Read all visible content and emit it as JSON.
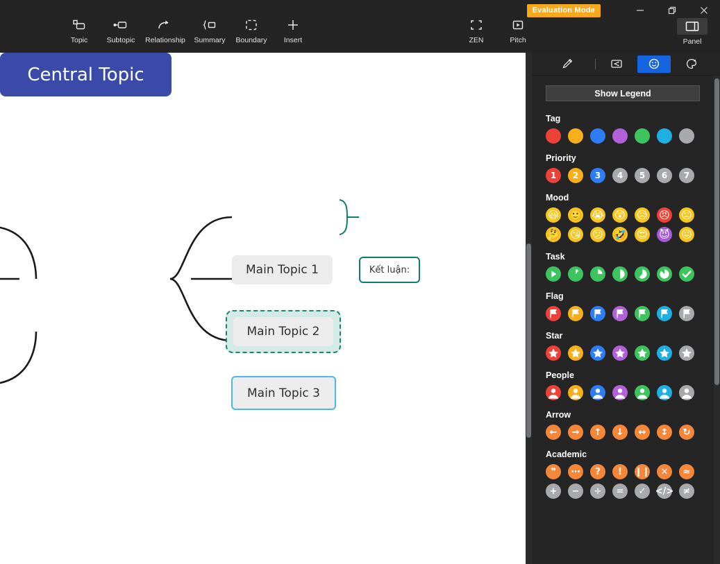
{
  "window": {
    "evaluation_badge": "Evaluation Mode",
    "minimize_icon": "minimize-icon",
    "maximize_icon": "restore-icon",
    "close_icon": "close-icon"
  },
  "toolbar": {
    "items": [
      {
        "label": "Topic",
        "icon": "topic-icon"
      },
      {
        "label": "Subtopic",
        "icon": "subtopic-icon"
      },
      {
        "label": "Relationship",
        "icon": "relationship-icon"
      },
      {
        "label": "Summary",
        "icon": "summary-icon"
      },
      {
        "label": "Boundary",
        "icon": "boundary-icon"
      },
      {
        "label": "Insert",
        "icon": "plus-icon"
      }
    ],
    "right_items": [
      {
        "label": "ZEN",
        "icon": "zen-icon"
      },
      {
        "label": "Pitch",
        "icon": "pitch-icon"
      }
    ],
    "panel": {
      "label": "Panel",
      "icon": "panel-icon"
    }
  },
  "canvas": {
    "central_topic": "Central Topic",
    "nodes": [
      {
        "id": "mt1",
        "label": "Main Topic 1"
      },
      {
        "id": "mt2",
        "label": "Main Topic 2"
      },
      {
        "id": "mt3",
        "label": "Main Topic 3"
      }
    ],
    "summary": {
      "label": "Kết luận:"
    }
  },
  "panel": {
    "tabs": [
      {
        "name": "style-tab",
        "icon": "brush-icon",
        "active": false
      },
      {
        "name": "outline-tab",
        "icon": "outline-icon",
        "active": false
      },
      {
        "name": "sticker-tab",
        "icon": "smiley-icon",
        "active": true
      },
      {
        "name": "theme-tab",
        "icon": "palette-icon",
        "active": false
      }
    ],
    "show_legend_label": "Show Legend",
    "sections": [
      {
        "title": "Tag",
        "kind": "dot",
        "items": [
          {
            "name": "tag-red",
            "color": "#EE4238",
            "label": ""
          },
          {
            "name": "tag-orange",
            "color": "#F7B01C",
            "label": ""
          },
          {
            "name": "tag-blue",
            "color": "#2D7DF6",
            "label": ""
          },
          {
            "name": "tag-purple",
            "color": "#B262D8",
            "label": ""
          },
          {
            "name": "tag-green",
            "color": "#3EC45E",
            "label": ""
          },
          {
            "name": "tag-cyan",
            "color": "#1EAFE3",
            "label": ""
          },
          {
            "name": "tag-gray",
            "color": "#A7A9AC",
            "label": ""
          }
        ]
      },
      {
        "title": "Priority",
        "kind": "number",
        "items": [
          {
            "name": "priority-1",
            "color": "#EE4238",
            "label": "1"
          },
          {
            "name": "priority-2",
            "color": "#F7B01C",
            "label": "2"
          },
          {
            "name": "priority-3",
            "color": "#2D7DF6",
            "label": "3"
          },
          {
            "name": "priority-4",
            "color": "#A7A9AC",
            "label": "4"
          },
          {
            "name": "priority-5",
            "color": "#A7A9AC",
            "label": "5"
          },
          {
            "name": "priority-6",
            "color": "#A7A9AC",
            "label": "6"
          },
          {
            "name": "priority-7",
            "color": "#A7A9AC",
            "label": "7"
          }
        ]
      },
      {
        "title": "Mood",
        "kind": "emoji",
        "items": [
          {
            "name": "mood-grin",
            "color": "#F7C51E",
            "label": "😃"
          },
          {
            "name": "mood-smile",
            "color": "#F7C51E",
            "label": "🙂"
          },
          {
            "name": "mood-cry",
            "color": "#F7C51E",
            "label": "😭"
          },
          {
            "name": "mood-shocked",
            "color": "#F7C51E",
            "label": "😲"
          },
          {
            "name": "mood-sad",
            "color": "#F7C51E",
            "label": "😥"
          },
          {
            "name": "mood-angry",
            "color": "#EE4238",
            "label": "😠"
          },
          {
            "name": "mood-neutral",
            "color": "#F7C51E",
            "label": "😐"
          },
          {
            "name": "mood-thinking",
            "color": "#F7C51E",
            "label": "🤔"
          },
          {
            "name": "mood-kiss",
            "color": "#F7C51E",
            "label": "😘"
          },
          {
            "name": "mood-confused",
            "color": "#F7C51E",
            "label": "😕"
          },
          {
            "name": "mood-rofl",
            "color": "#F7C51E",
            "label": "🤣"
          },
          {
            "name": "mood-heart-eyes",
            "color": "#F7C51E",
            "label": "😍"
          },
          {
            "name": "mood-devil",
            "color": "#A35BD8",
            "label": "😈"
          },
          {
            "name": "mood-x-eyes",
            "color": "#F7C51E",
            "label": "😖"
          }
        ]
      },
      {
        "title": "Task",
        "kind": "progress",
        "items": [
          {
            "name": "task-start",
            "color": "#3EC45E",
            "label": "",
            "progress": 0
          },
          {
            "name": "task-1-8",
            "color": "#3EC45E",
            "label": "",
            "progress": 12
          },
          {
            "name": "task-1-4",
            "color": "#3EC45E",
            "label": "",
            "progress": 25
          },
          {
            "name": "task-1-2",
            "color": "#3EC45E",
            "label": "",
            "progress": 50
          },
          {
            "name": "task-5-8",
            "color": "#3EC45E",
            "label": "",
            "progress": 62
          },
          {
            "name": "task-7-8",
            "color": "#3EC45E",
            "label": "",
            "progress": 87
          },
          {
            "name": "task-done",
            "color": "#3EC45E",
            "label": "✓",
            "progress": 100
          }
        ]
      },
      {
        "title": "Flag",
        "kind": "flag",
        "items": [
          {
            "name": "flag-red",
            "color": "#EE4238",
            "label": ""
          },
          {
            "name": "flag-orange",
            "color": "#F7B01C",
            "label": ""
          },
          {
            "name": "flag-blue",
            "color": "#2D7DF6",
            "label": ""
          },
          {
            "name": "flag-purple",
            "color": "#B262D8",
            "label": ""
          },
          {
            "name": "flag-green",
            "color": "#3EC45E",
            "label": ""
          },
          {
            "name": "flag-cyan",
            "color": "#1EAFE3",
            "label": ""
          },
          {
            "name": "flag-gray",
            "color": "#A7A9AC",
            "label": ""
          }
        ]
      },
      {
        "title": "Star",
        "kind": "star",
        "items": [
          {
            "name": "star-red",
            "color": "#EE4238",
            "label": ""
          },
          {
            "name": "star-orange",
            "color": "#F7B01C",
            "label": ""
          },
          {
            "name": "star-blue",
            "color": "#2D7DF6",
            "label": ""
          },
          {
            "name": "star-purple",
            "color": "#B262D8",
            "label": ""
          },
          {
            "name": "star-green",
            "color": "#3EC45E",
            "label": ""
          },
          {
            "name": "star-cyan",
            "color": "#1EAFE3",
            "label": ""
          },
          {
            "name": "star-gray",
            "color": "#A7A9AC",
            "label": ""
          }
        ]
      },
      {
        "title": "People",
        "kind": "person",
        "items": [
          {
            "name": "people-red",
            "color": "#EE4238",
            "label": ""
          },
          {
            "name": "people-orange",
            "color": "#F7B01C",
            "label": ""
          },
          {
            "name": "people-blue",
            "color": "#2D7DF6",
            "label": ""
          },
          {
            "name": "people-purple",
            "color": "#B262D8",
            "label": ""
          },
          {
            "name": "people-green",
            "color": "#3EC45E",
            "label": ""
          },
          {
            "name": "people-cyan",
            "color": "#1EAFE3",
            "label": ""
          },
          {
            "name": "people-gray",
            "color": "#A7A9AC",
            "label": ""
          }
        ]
      },
      {
        "title": "Arrow",
        "kind": "glyph",
        "items": [
          {
            "name": "arrow-left",
            "color": "#F5873B",
            "label": "←"
          },
          {
            "name": "arrow-right",
            "color": "#F5873B",
            "label": "→"
          },
          {
            "name": "arrow-up",
            "color": "#F5873B",
            "label": "↑"
          },
          {
            "name": "arrow-down",
            "color": "#F5873B",
            "label": "↓"
          },
          {
            "name": "arrow-left-right",
            "color": "#F5873B",
            "label": "↔"
          },
          {
            "name": "arrow-up-down",
            "color": "#F5873B",
            "label": "↕"
          },
          {
            "name": "arrow-refresh",
            "color": "#F5873B",
            "label": "↻"
          }
        ]
      },
      {
        "title": "Academic",
        "kind": "glyph",
        "items": [
          {
            "name": "academic-quote",
            "color": "#F5873B",
            "label": "❞"
          },
          {
            "name": "academic-ellipsis",
            "color": "#F5873B",
            "label": "⋯"
          },
          {
            "name": "academic-question",
            "color": "#F5873B",
            "label": "?"
          },
          {
            "name": "academic-exclamation",
            "color": "#F5873B",
            "label": "!"
          },
          {
            "name": "academic-pause",
            "color": "#F5873B",
            "label": "❙❙"
          },
          {
            "name": "academic-cross",
            "color": "#F5873B",
            "label": "✕"
          },
          {
            "name": "academic-approx",
            "color": "#F5873B",
            "label": "≈"
          },
          {
            "name": "academic-plus",
            "color": "#A7A9AC",
            "label": "+"
          },
          {
            "name": "academic-minus",
            "color": "#A7A9AC",
            "label": "−"
          },
          {
            "name": "academic-divide",
            "color": "#A7A9AC",
            "label": "÷"
          },
          {
            "name": "academic-equals",
            "color": "#A7A9AC",
            "label": "="
          },
          {
            "name": "academic-check",
            "color": "#A7A9AC",
            "label": "✓"
          },
          {
            "name": "academic-code",
            "color": "#A7A9AC",
            "label": "</>"
          },
          {
            "name": "academic-not-equal",
            "color": "#A7A9AC",
            "label": "≠"
          }
        ]
      }
    ]
  }
}
